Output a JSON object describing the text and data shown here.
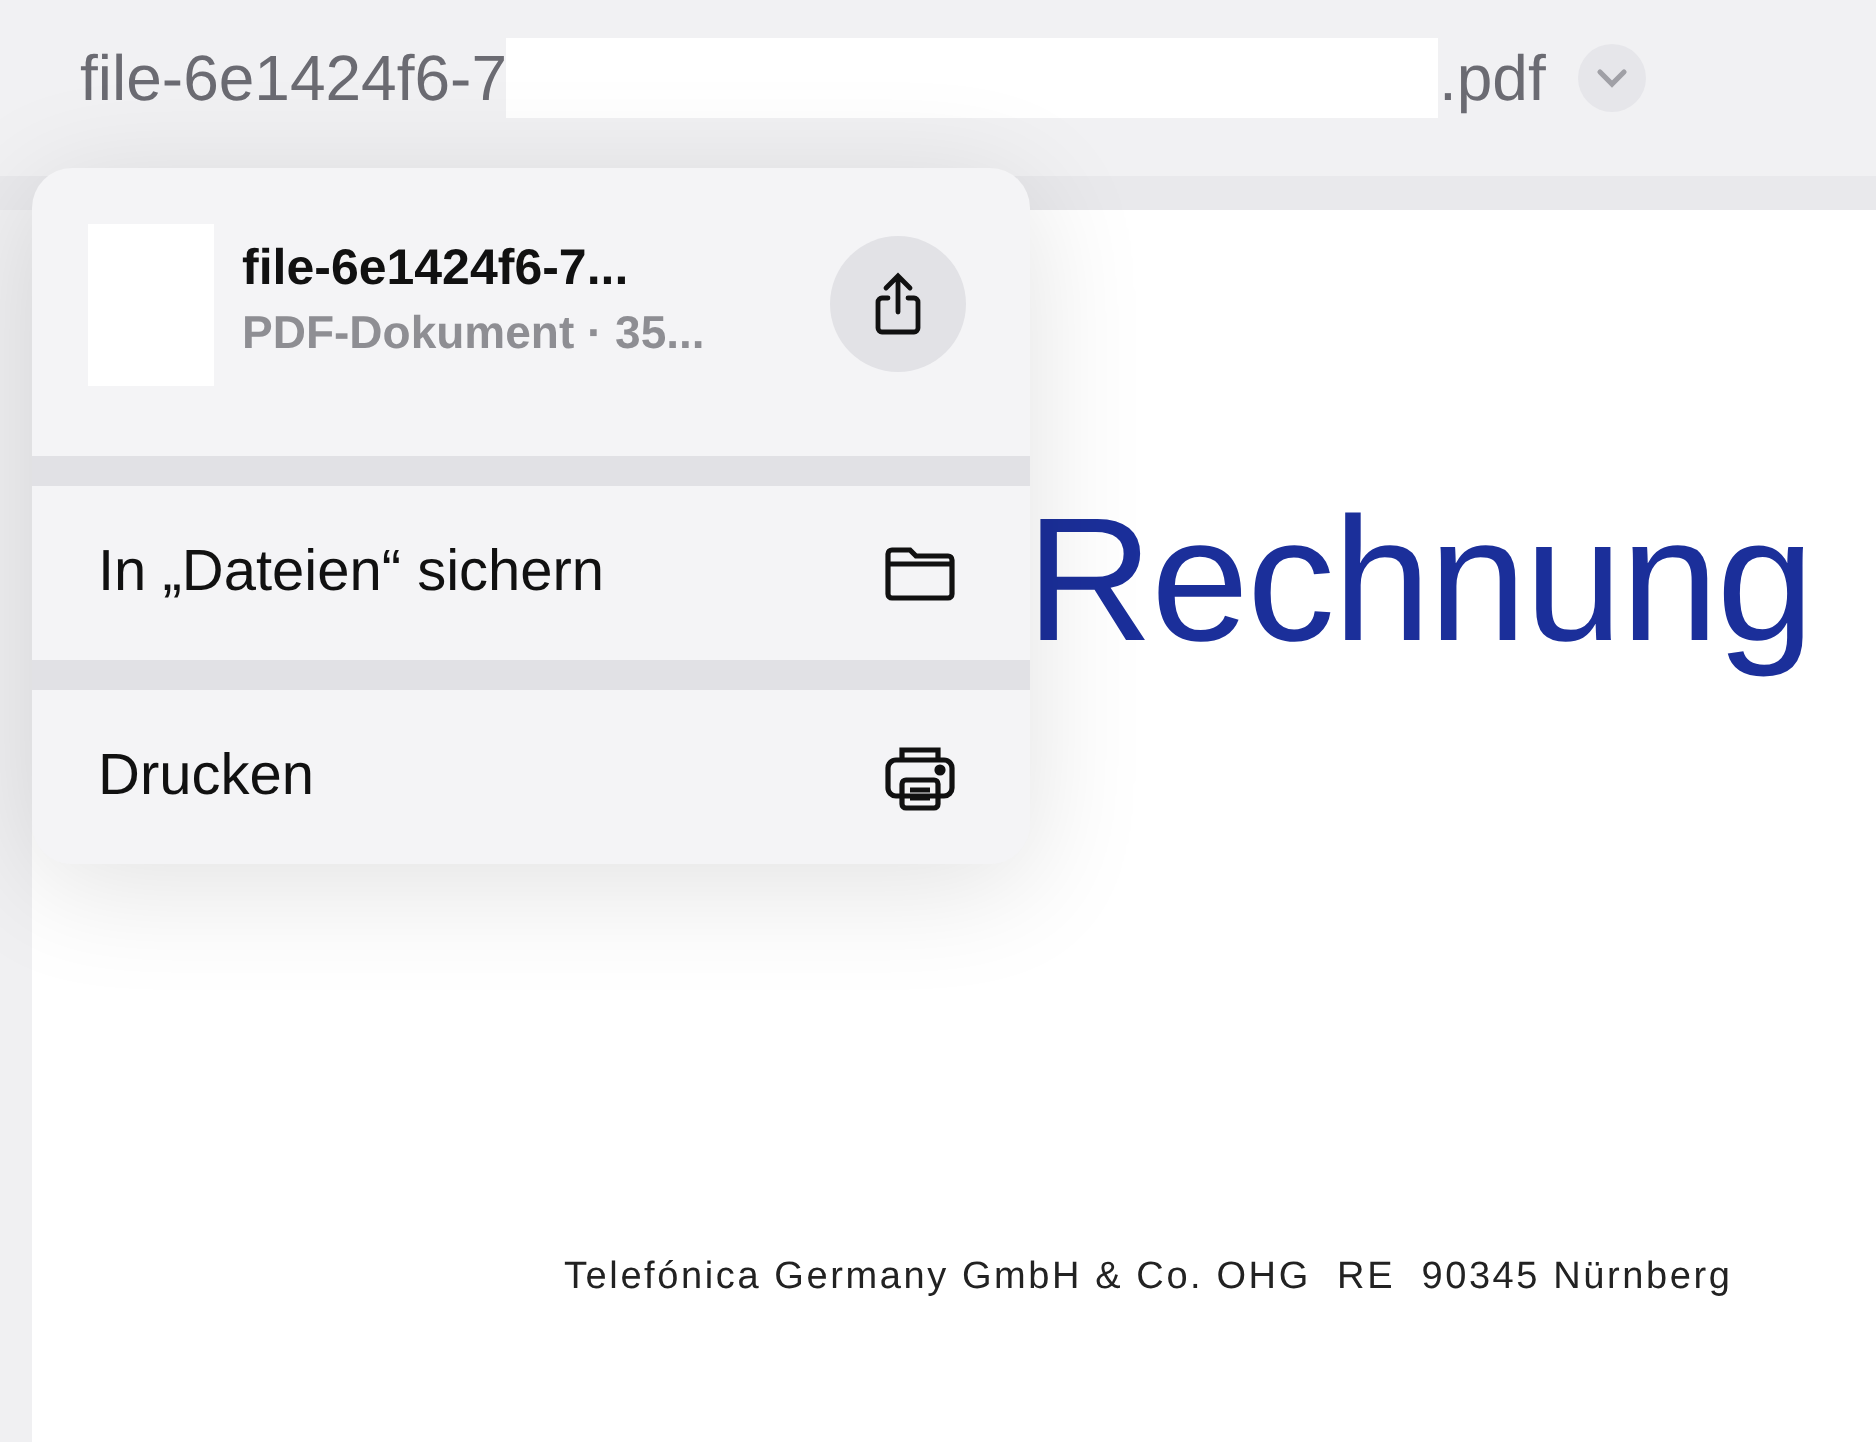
{
  "title_bar": {
    "title_start": "file-6e1424f6-7",
    "title_end": ".pdf",
    "redacted": true
  },
  "menu": {
    "file_name": "file-6e1424f6-7...",
    "file_info": "PDF-Dokument · 35...",
    "items": [
      {
        "label": "In „Dateien“ sichern",
        "kind": "folder"
      },
      {
        "label": "Drucken",
        "kind": "print"
      }
    ]
  },
  "document": {
    "heading": "Rechnung",
    "footer": "Telefónica Germany GmbH & Co. OHG  RE  90345 Nürnberg"
  }
}
